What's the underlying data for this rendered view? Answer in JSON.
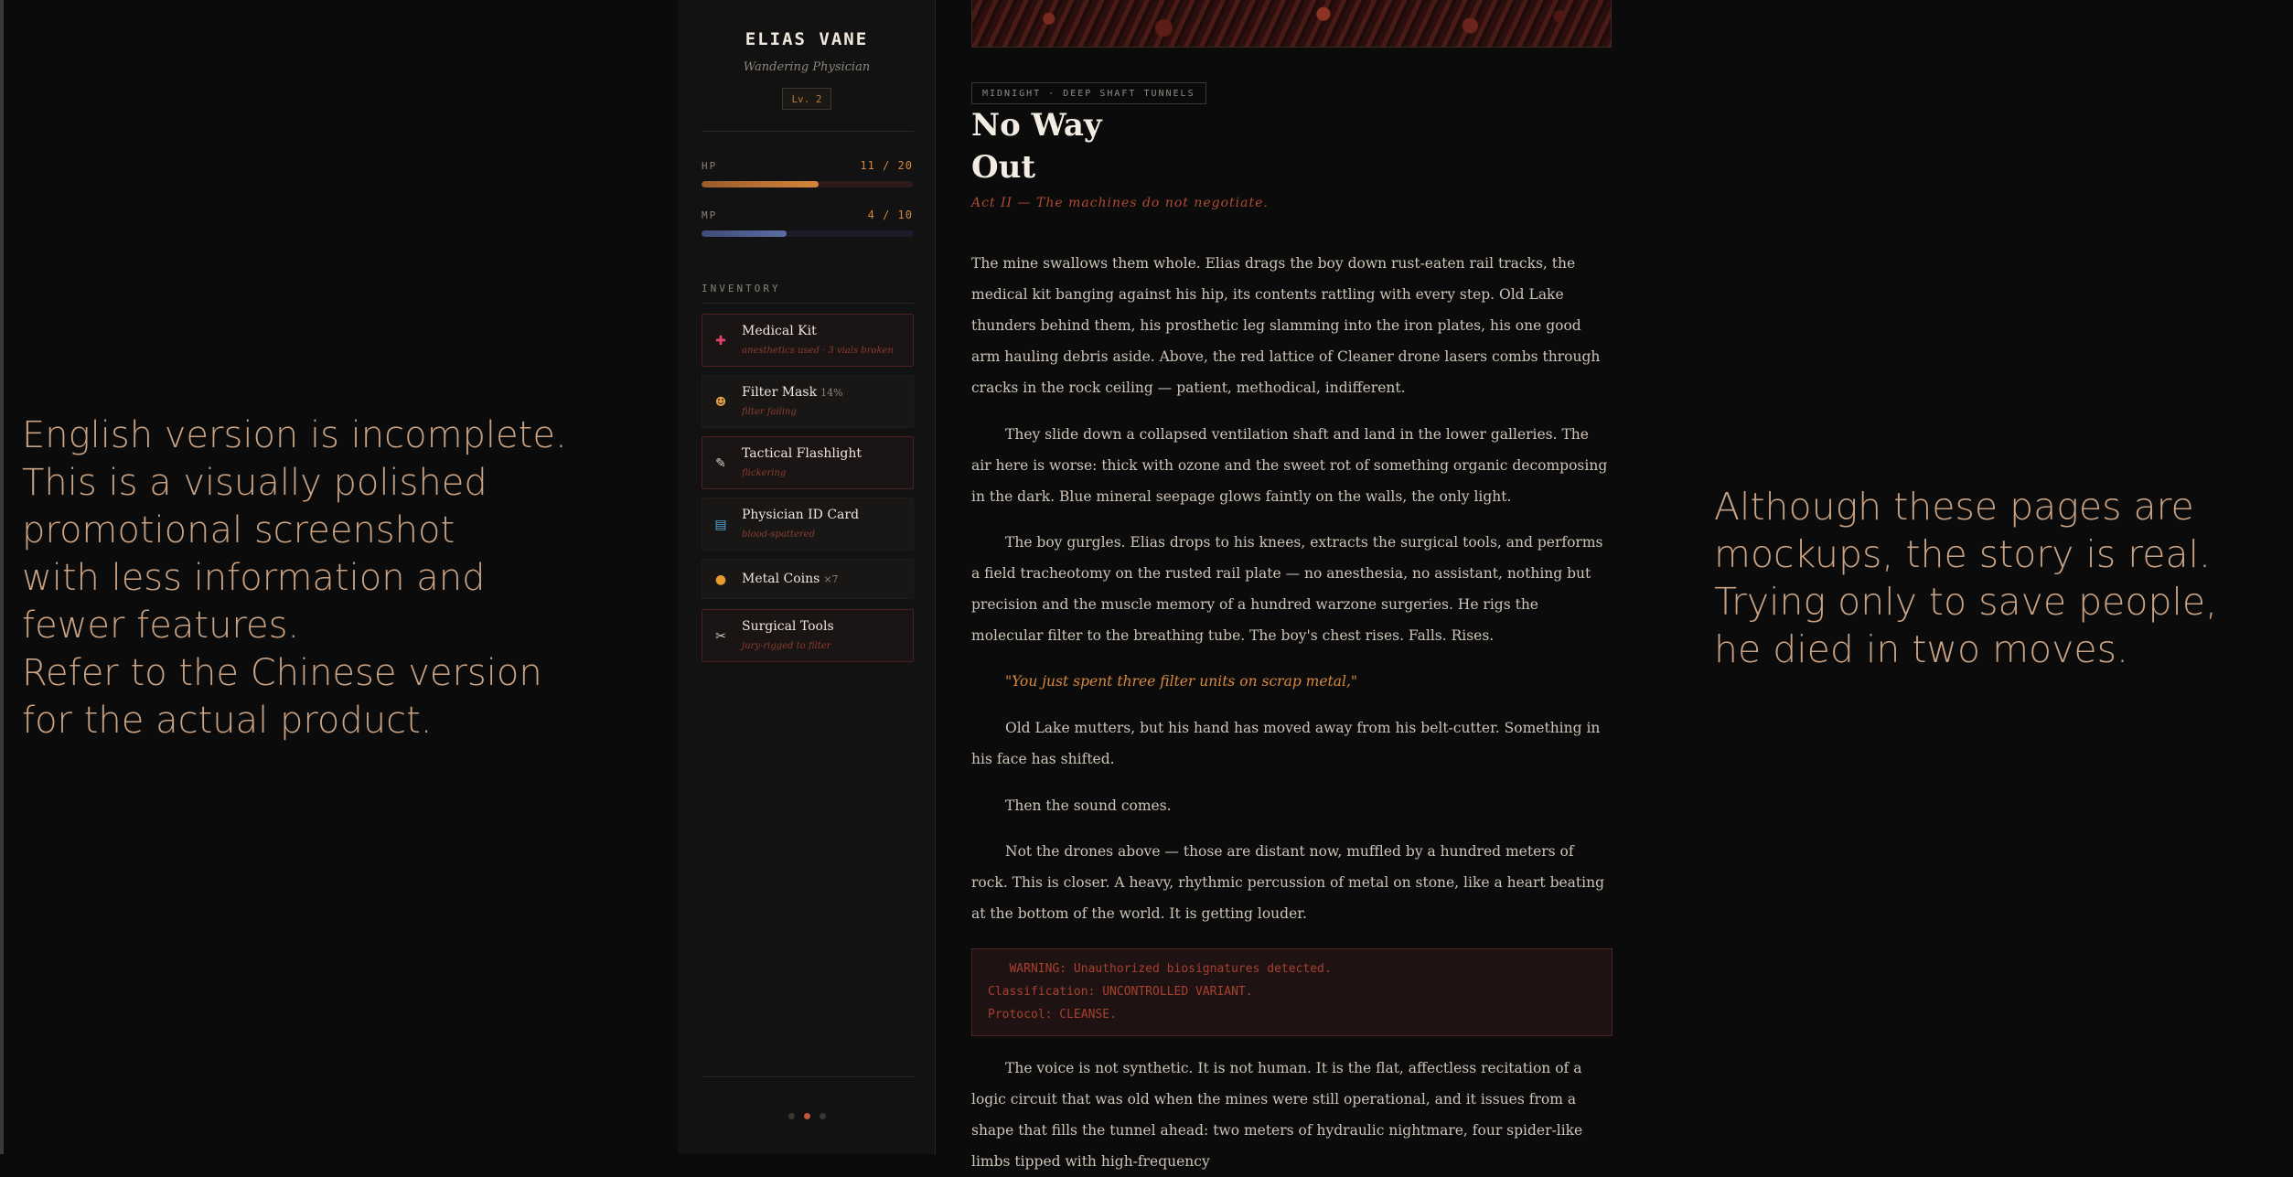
{
  "notes": {
    "left": "English version is incomplete.\nThis is a visually polished\npromotional screenshot\nwith less information and\nfewer features.\nRefer to the Chinese version\nfor the actual product.",
    "right": "Although these pages are\nmockups, the story is real.\nTrying only to save people,\nhe died in two moves."
  },
  "character": {
    "name": "ELIAS VANE",
    "subtitle": "Wandering Physician",
    "level": "Lv. 2",
    "hp": {
      "label": "HP",
      "value": "11 / 20",
      "current": 11,
      "max": 20
    },
    "mp": {
      "label": "MP",
      "value": "4 / 10",
      "current": 4,
      "max": 10
    }
  },
  "inventory": {
    "label": "INVENTORY",
    "items": [
      {
        "name": "Medical Kit",
        "extra": "",
        "status": "anesthetics used · 3 vials broken",
        "icon": "medkit-icon",
        "glyph": "✚",
        "color": "#e0456b",
        "broken": true
      },
      {
        "name": "Filter Mask",
        "extra": "14%",
        "status": "filter failing",
        "icon": "mask-icon",
        "glyph": "☻",
        "color": "#e3a04a",
        "broken": false
      },
      {
        "name": "Tactical Flashlight",
        "extra": "",
        "status": "flickering",
        "icon": "flashlight-icon",
        "glyph": "✎",
        "color": "#d8d2c8",
        "broken": true
      },
      {
        "name": "Physician ID Card",
        "extra": "",
        "status": "blood-spattered",
        "icon": "id-card-icon",
        "glyph": "▤",
        "color": "#5aa6d8",
        "broken": false
      },
      {
        "name": "Metal Coins",
        "extra": "×7",
        "status": "",
        "icon": "coin-icon",
        "glyph": "●",
        "color": "#e89a2e",
        "broken": false
      },
      {
        "name": "Surgical Tools",
        "extra": "",
        "status": "jury-rigged to filter",
        "icon": "wrench-icon",
        "glyph": "✂",
        "color": "#cfc8c0",
        "broken": true
      }
    ]
  },
  "pagination": {
    "count": 3,
    "active": 1
  },
  "chapter": {
    "location": "MIDNIGHT · DEEP SHAFT TUNNELS",
    "title": "No Way Out",
    "subtitle": "Act II — The machines do not negotiate.",
    "paragraphs": [
      "The mine swallows them whole. Elias drags the boy down rust-eaten rail tracks, the medical kit banging against his hip, its contents rattling with every step. Old Lake thunders behind them, his prosthetic leg slamming into the iron plates, his one good arm hauling debris aside. Above, the red lattice of Cleaner drone lasers combs through cracks in the rock ceiling — patient, methodical, indifferent.",
      "They slide down a collapsed ventilation shaft and land in the lower galleries. The air here is worse: thick with ozone and the sweet rot of something organic decomposing in the dark. Blue mineral seepage glows faintly on the walls, the only light.",
      "The boy gurgles. Elias drops to his knees, extracts the surgical tools, and performs a field tracheotomy on the rusted rail plate — no anesthesia, no assistant, nothing but precision and the muscle memory of a hundred warzone surgeries. He rigs the molecular filter to the breathing tube. The boy's chest rises. Falls. Rises.",
      "\"You just spent three filter units on scrap metal,\"",
      "Old Lake mutters, but his hand has moved away from his belt-cutter. Something in his face has shifted.",
      "Then the sound comes.",
      "Not the drones above — those are distant now, muffled by a hundred meters of rock. This is closer. A heavy, rhythmic percussion of metal on stone, like a heart beating at the bottom of the world. It is getting louder.",
      "The voice is not synthetic. It is not human. It is the flat, affectless recitation of a logic circuit that was old when the mines were still operational, and it issues from a shape that fills the tunnel ahead: two meters of hydraulic nightmare, four spider-like limbs tipped with high-frequency"
    ],
    "terminal": "   WARNING: Unauthorized biosignatures detected.\nClassification: UNCONTROLLED VARIANT.\nProtocol: CLEANSE."
  }
}
